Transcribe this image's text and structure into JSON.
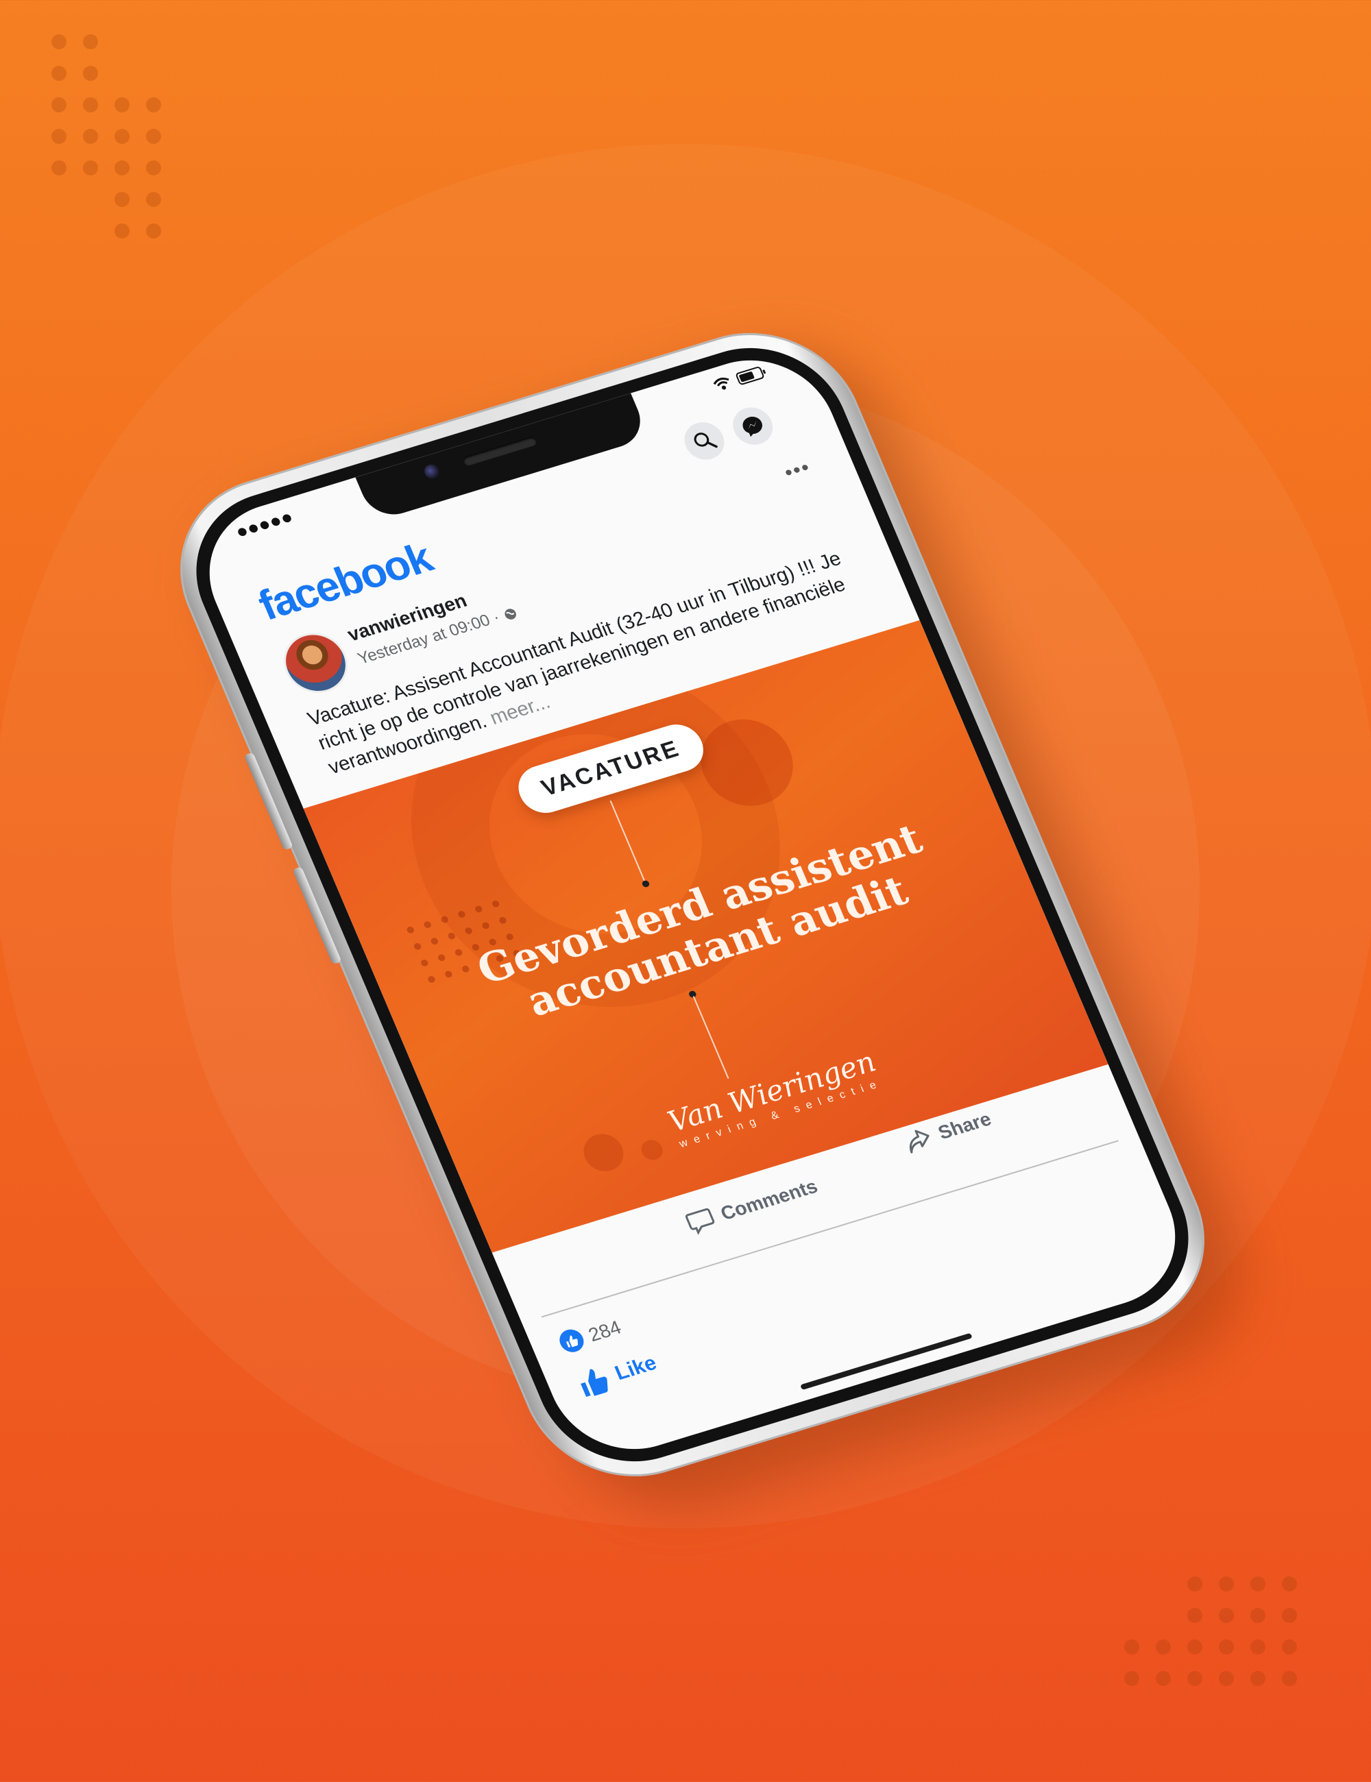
{
  "app": {
    "logo": "facebook"
  },
  "icons": {
    "search": "search-icon",
    "messenger": "messenger-icon",
    "more": "more-dots-icon",
    "globe": "globe-icon",
    "like": "thumbs-up-icon",
    "comment": "comment-icon",
    "share": "share-icon"
  },
  "colors": {
    "facebook_blue": "#1877f2",
    "background_orange": "#f26a1f"
  },
  "post": {
    "author": "vanwieringen",
    "time": "Yesterday at 09:00",
    "separator": "·",
    "text": "Vacature: Assisent Accountant Audit (32-40 uur in Tilburg) !!! Je richt je op de controle van jaarrekeningen en andere financiële verantwoordingen.",
    "more": "meer...",
    "image": {
      "badge": "VACATURE",
      "title": "Gevorderd assistent accountant audit",
      "brand": "Van Wieringen",
      "brand_tagline": "werving & selectie"
    },
    "likes": "284",
    "actions": {
      "like": "Like",
      "comments": "Comments",
      "share": "Share"
    }
  }
}
